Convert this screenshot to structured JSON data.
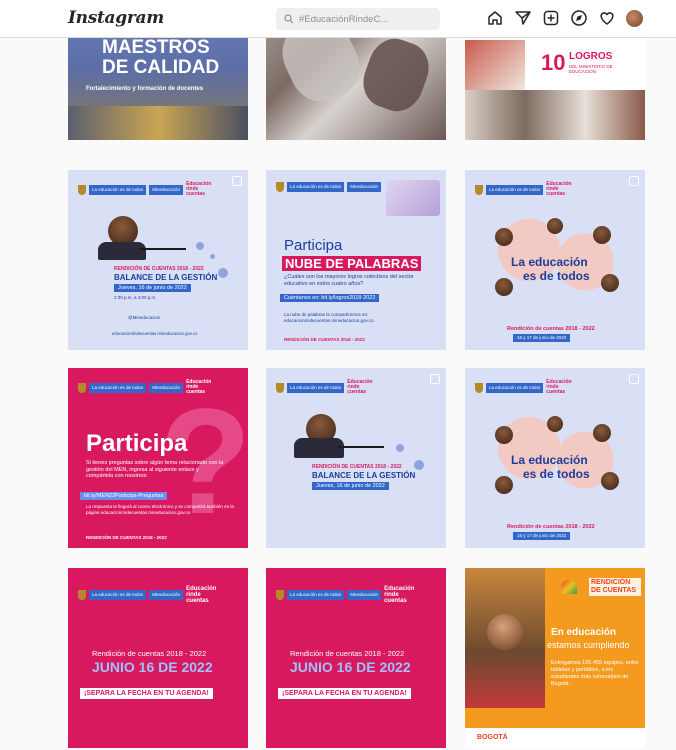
{
  "header": {
    "logo": "Instagram",
    "search_placeholder": "#EducaciónRindeC..."
  },
  "colors": {
    "lavender": "#d9e0f5",
    "magenta": "#d9195f",
    "orange": "#f39a1f",
    "blue": "#1d3d9a"
  },
  "icons": [
    "home-icon",
    "direct-icon",
    "new-post-icon",
    "explore-icon",
    "heart-icon",
    "avatar"
  ],
  "tiles": {
    "t1": {
      "title_1": "MAESTROS",
      "title_2": "DE CALIDAD",
      "subtitle": "Fortalecimiento y formación de docentes"
    },
    "t3": {
      "number": "10",
      "title": "LOGROS",
      "subtitle": "DEL MINISTERIO DE EDUCACIÓN"
    },
    "gov": {
      "gov_label": "La educación es de todos",
      "mineducacion": "Mineducación",
      "campaign": "Educación rinde cuentas"
    },
    "t4": {
      "line1": "RENDICIÓN DE CUENTAS 2018 - 2022",
      "line2": "BALANCE DE LA GESTIÓN",
      "date": "Jueves, 16 de junio de 2022",
      "time": "2:30 p.m. a 4:00 p.m.",
      "handle": "@Mineducacion",
      "url": "educacionrindecuentas.mineducacion.gov.co"
    },
    "t5": {
      "title_1": "Participa",
      "title_2": "NUBE DE PALABRAS",
      "question": "¿Cuáles son los mayores logros colectivos del sector educativo en estos cuatro años?",
      "link": "Cuéntanos en: bit.ly/logros2018-2022",
      "body": "La nube de palabras la compartiremos en: educacionrindecuentas.mineducacion.gov.co",
      "footer": "RENDICIÓN DE CUENTAS 2018 - 2022"
    },
    "t6": {
      "title_1": "La educación",
      "title_2": "es de todos",
      "footer": "Rendición de cuentas 2018 - 2022",
      "date": "16 y 17 de junio de 2022"
    },
    "t7": {
      "title": "Participa",
      "body": "Si tienes preguntas sobre algún tema relacionado con la gestión del MEN, ingresa al siguiente enlace y compártela con nosotros:",
      "link": "bit.ly/MEN22Participa-Preguntas",
      "body2": "La respuesta te llegará al correo electrónico y se compartirá también en la página educacionrindecuentas.mineducacion.gov.co",
      "footer": "RENDICIÓN DE CUENTAS 2018 - 2022"
    },
    "t8": {
      "line1": "RENDICIÓN DE CUENTAS 2018 - 2022",
      "line2": "BALANCE DE LA GESTIÓN",
      "date": "Jueves, 16 de junio de 2022"
    },
    "t9": {
      "title_1": "La educación",
      "title_2": "es de todos",
      "footer": "Rendición de cuentas 2018 - 2022",
      "date": "16 y 17 de junio de 2022"
    },
    "t10": {
      "line1": "Rendición de cuentas 2018 - 2022",
      "line2": "JUNIO 16 DE 2022",
      "cta": "¡SEPARA LA FECHA EN TU AGENDA!"
    },
    "t11": {
      "line1": "Rendición de cuentas 2018 - 2022",
      "line2": "JUNIO 16 DE 2022",
      "cta": "¡SEPARA LA FECHA EN TU AGENDA!"
    },
    "t12": {
      "badge": "RENDICIÓN DE CUENTAS",
      "title_1": "En educación",
      "title_2": "estamos cumpliendo",
      "body": "Entregamos 105.455 equipos, entre tabletas y portátiles, a los estudiantes más vulnerables de Bogotá.",
      "footer_logo": "BOGOTÁ"
    }
  }
}
